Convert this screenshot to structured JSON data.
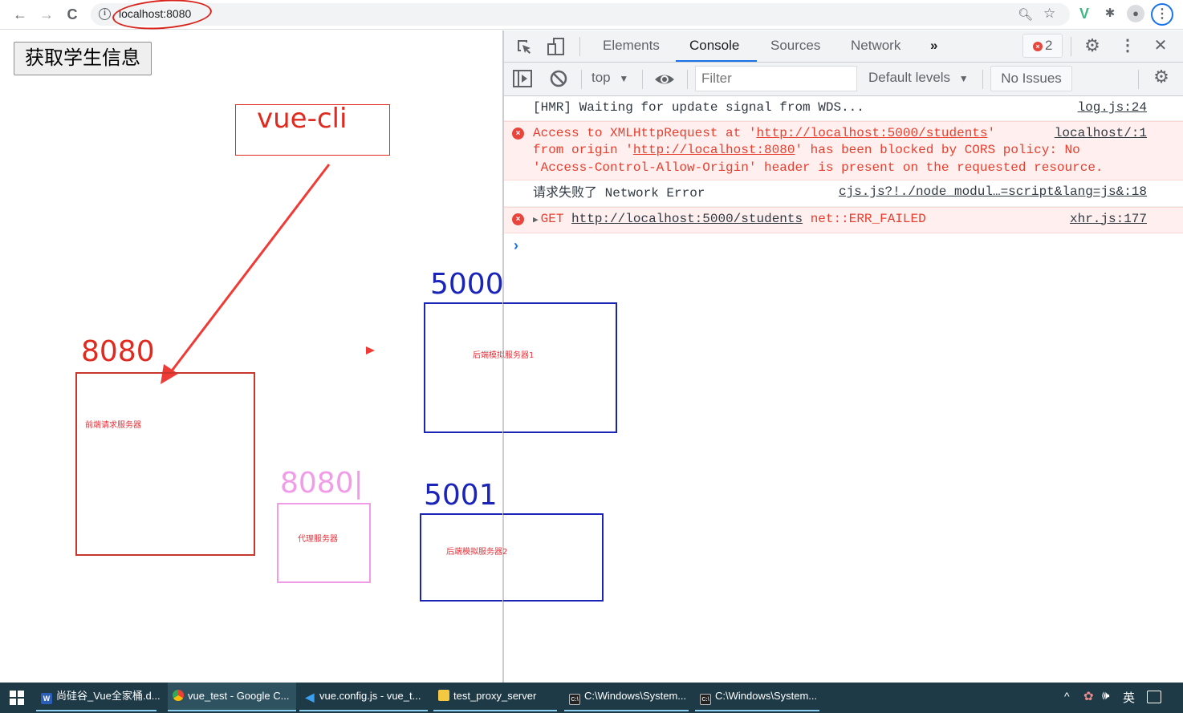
{
  "browser": {
    "url": "localhost:8080",
    "nav": {
      "back": "←",
      "forward": "→",
      "reload": "C"
    }
  },
  "page": {
    "fetch_button_label": "获取学生信息"
  },
  "devtools": {
    "tabs": [
      "Elements",
      "Console",
      "Sources",
      "Network"
    ],
    "active_tab": "Console",
    "more_tabs": "»",
    "error_count": "2",
    "context": "top",
    "filter_placeholder": "Filter",
    "levels_label": "Default levels",
    "issues_label": "No Issues",
    "console_messages": [
      {
        "type": "log",
        "text": "[HMR] Waiting for update signal from WDS...",
        "source": "log.js:24"
      },
      {
        "type": "error",
        "parts": {
          "p1": "Access to XMLHttpRequest at '",
          "link1": "http://localhost:5000/students",
          "p2": "'",
          "line2a": "from origin '",
          "link2": "http://localhost:8080",
          "line2b": "' has been blocked by CORS policy: No",
          "line3": "'Access-Control-Allow-Origin' header is present on the requested resource."
        },
        "source": "localhost/:1"
      },
      {
        "type": "log",
        "text_zh": "请求失败了",
        "text": " Network Error",
        "source": "cjs.js?!./node_modul…=script&lang=js&:18"
      },
      {
        "type": "error",
        "method": "GET",
        "link": "http://localhost:5000/students",
        "status": "net::ERR_FAILED",
        "source": "xhr.js:177"
      }
    ],
    "prompt": "›"
  },
  "annotations": {
    "vue_cli_label": "vue-cli",
    "frontend_port": "8080",
    "frontend_label": "前端请求服务器",
    "proxy_port": "8080|",
    "proxy_label": "代理服务器",
    "backend1_port": "5000",
    "backend1_label": "后端模拟服务器1",
    "backend2_port": "5001",
    "backend2_label": "后端模拟服务器2",
    "colors": {
      "red": "#e02a1f",
      "pink": "#f09ce8",
      "blue": "#1a24b8",
      "label_red": "#e8333b"
    }
  },
  "taskbar": {
    "items": [
      {
        "label": "尚硅谷_Vue全家桶.d...",
        "icon": "word-icon"
      },
      {
        "label": "vue_test - Google C...",
        "icon": "chrome-icon"
      },
      {
        "label": "vue.config.js - vue_t...",
        "icon": "vscode-icon"
      },
      {
        "label": "test_proxy_server",
        "icon": "folder-icon"
      },
      {
        "label": "C:\\Windows\\System...",
        "icon": "cmd-icon"
      },
      {
        "label": "C:\\Windows\\System...",
        "icon": "cmd-icon"
      }
    ],
    "tray": {
      "chevron": "^",
      "ime": "英"
    }
  }
}
